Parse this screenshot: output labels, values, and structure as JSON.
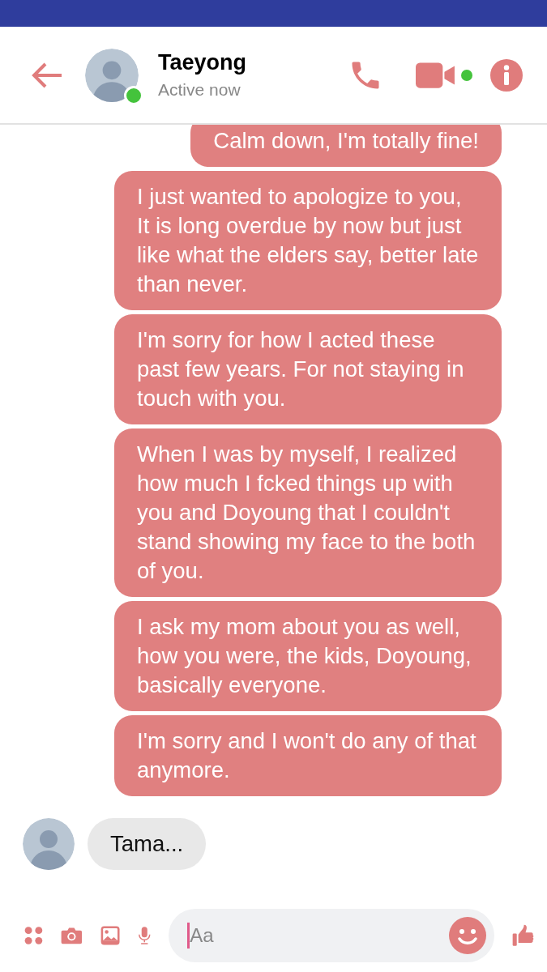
{
  "contact": {
    "name": "Taeyong",
    "status": "Active now",
    "online": true
  },
  "messages": [
    {
      "kind": "sent",
      "text": "Calm down, I'm totally fine!"
    },
    {
      "kind": "sent",
      "text": "I just wanted to apologize to you, It is long overdue by now but just like what the elders say, better late than never."
    },
    {
      "kind": "sent",
      "text": "I'm sorry for how I acted these past few years. For not staying in touch with you."
    },
    {
      "kind": "sent",
      "text": "When I was by myself, I realized how much I fcked things up with you and Doyoung that I couldn't stand showing my face to the both of you."
    },
    {
      "kind": "sent",
      "text": "I ask my mom about you as well, how you were,  the kids, Doyoung, basically everyone."
    },
    {
      "kind": "sent",
      "text": "I'm sorry and I won't do any of that anymore."
    },
    {
      "kind": "received",
      "text": "Tama..."
    }
  ],
  "composer": {
    "placeholder": "Aa"
  }
}
